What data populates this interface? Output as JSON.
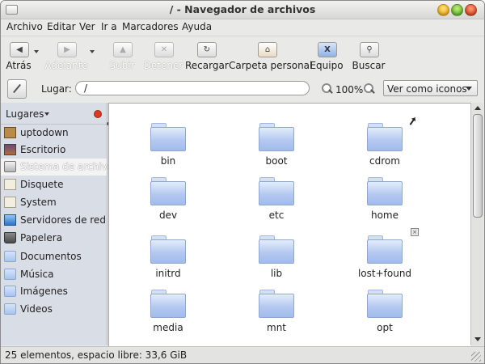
{
  "window": {
    "title": "/ - Navegador de archivos"
  },
  "menubar": {
    "items": [
      "Archivo",
      "Editar",
      "Ver",
      "Ir a",
      "Marcadores",
      "Ayuda"
    ]
  },
  "toolbar": {
    "back": {
      "label": "Atrás",
      "icon": "left-arrow-icon",
      "enabled": true
    },
    "forward": {
      "label": "Adelante",
      "icon": "right-arrow-icon",
      "enabled": false
    },
    "up": {
      "label": "Subir",
      "icon": "up-arrow-icon",
      "enabled": false
    },
    "stop": {
      "label": "Detener",
      "icon": "stop-icon",
      "enabled": false
    },
    "reload": {
      "label": "Recargar",
      "icon": "reload-icon",
      "enabled": true
    },
    "home": {
      "label": "Carpeta personal",
      "icon": "home-icon",
      "enabled": true
    },
    "computer": {
      "label": "Equipo",
      "icon": "computer-icon",
      "enabled": true
    },
    "search": {
      "label": "Buscar",
      "icon": "search-icon",
      "enabled": true
    }
  },
  "location": {
    "label": "Lugar:",
    "value": "/",
    "zoom": "100%",
    "view_mode": "Ver como iconos"
  },
  "sidebar": {
    "header": "Lugares",
    "items": [
      {
        "label": "uptodown",
        "icon": "home-icon"
      },
      {
        "label": "Escritorio",
        "icon": "desktop-icon"
      },
      {
        "label": "Sistema de archivos",
        "icon": "drive-icon",
        "selected": true
      },
      {
        "label": "Disquete",
        "icon": "floppy-icon"
      },
      {
        "label": "System",
        "icon": "floppy-icon"
      },
      {
        "label": "Servidores de red",
        "icon": "network-icon"
      },
      {
        "label": "Papelera",
        "icon": "trash-icon"
      },
      {
        "label": "Documentos",
        "icon": "folder-icon"
      },
      {
        "label": "Música",
        "icon": "folder-icon"
      },
      {
        "label": "Imágenes",
        "icon": "folder-icon"
      },
      {
        "label": "Videos",
        "icon": "folder-icon"
      }
    ]
  },
  "files": [
    {
      "name": "bin"
    },
    {
      "name": "boot"
    },
    {
      "name": "cdrom",
      "emblem": "symbolic-link"
    },
    {
      "name": "dev"
    },
    {
      "name": "etc"
    },
    {
      "name": "home"
    },
    {
      "name": "initrd"
    },
    {
      "name": "lib"
    },
    {
      "name": "lost+found",
      "emblem": "locked"
    },
    {
      "name": "media"
    },
    {
      "name": "mnt"
    },
    {
      "name": "opt"
    }
  ],
  "status": {
    "text": "25 elementos, espacio libre: 33,6 GiB"
  },
  "colors": {
    "sidebar_bg": "#d9dde6",
    "folder_blue": "#a9c3ee",
    "close_red": "#d2330c",
    "min_yellow": "#f0a100",
    "max_green": "#4aa51a"
  }
}
